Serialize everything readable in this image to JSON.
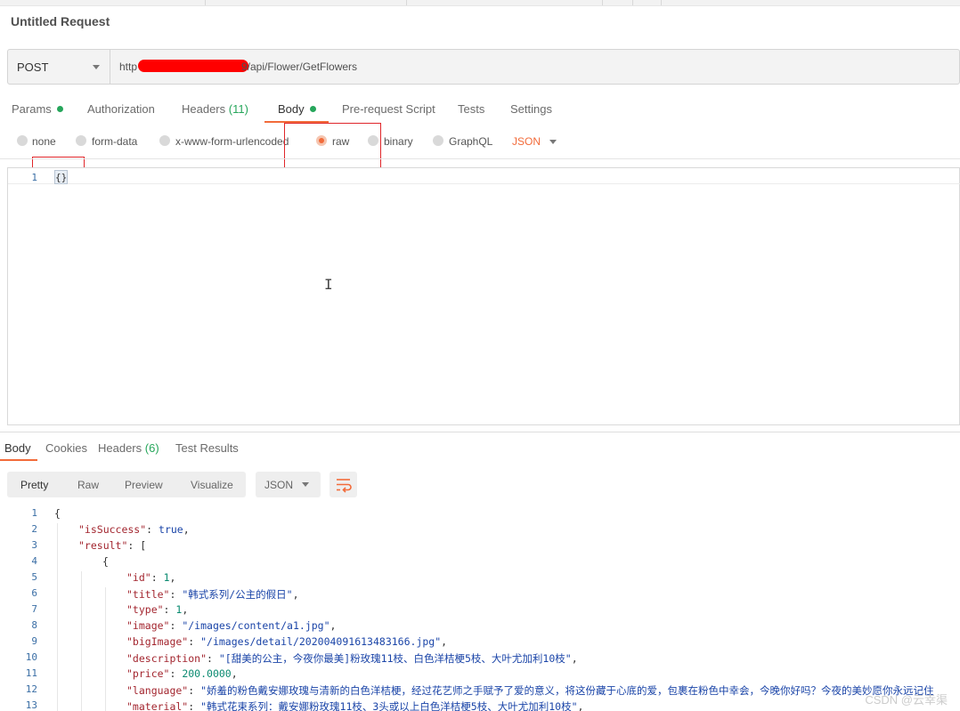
{
  "title": "Untitled Request",
  "request": {
    "method": "POST",
    "url_prefix": "http",
    "url_suffix": "9/api/Flower/GetFlowers",
    "tabs": [
      {
        "label": "Params"
      },
      {
        "label": "Authorization"
      },
      {
        "label": "Headers",
        "count": "(11)"
      },
      {
        "label": "Body"
      },
      {
        "label": "Pre-request Script"
      },
      {
        "label": "Tests"
      },
      {
        "label": "Settings"
      }
    ],
    "body_types": [
      "none",
      "form-data",
      "x-www-form-urlencoded",
      "raw",
      "binary",
      "GraphQL"
    ],
    "selected_body_type": "raw",
    "format": "JSON",
    "editor_line_number": "1",
    "editor_content": "{}"
  },
  "response": {
    "tabs": [
      {
        "label": "Body"
      },
      {
        "label": "Cookies"
      },
      {
        "label": "Headers",
        "count": "(6)"
      },
      {
        "label": "Test Results"
      }
    ],
    "view_modes": [
      "Pretty",
      "Raw",
      "Preview",
      "Visualize"
    ],
    "format": "JSON",
    "lines": [
      {
        "no": "1",
        "text": "{"
      },
      {
        "no": "2",
        "key": "\"isSuccess\"",
        "value": "true",
        "type": "b",
        "tail": ",",
        "indent": 1
      },
      {
        "no": "3",
        "key": "\"result\"",
        "value": "[",
        "type": "p",
        "indent": 1
      },
      {
        "no": "4",
        "text": "{",
        "indent": 2
      },
      {
        "no": "5",
        "key": "\"id\"",
        "value": "1",
        "type": "n",
        "tail": ",",
        "indent": 3
      },
      {
        "no": "6",
        "key": "\"title\"",
        "value": "\"韩式系列/公主的假日\"",
        "type": "s",
        "tail": ",",
        "indent": 3
      },
      {
        "no": "7",
        "key": "\"type\"",
        "value": "1",
        "type": "n",
        "tail": ",",
        "indent": 3
      },
      {
        "no": "8",
        "key": "\"image\"",
        "value": "\"/images/content/a1.jpg\"",
        "type": "s",
        "tail": ",",
        "indent": 3
      },
      {
        "no": "9",
        "key": "\"bigImage\"",
        "value": "\"/images/detail/202004091613483166.jpg\"",
        "type": "s",
        "tail": ",",
        "indent": 3
      },
      {
        "no": "10",
        "key": "\"description\"",
        "value": "\"[甜美的公主，今夜你最美]粉玫瑰11枝、白色洋桔梗5枝、大叶尤加利10枝\"",
        "type": "s",
        "tail": ",",
        "indent": 3
      },
      {
        "no": "11",
        "key": "\"price\"",
        "value": "200.0000",
        "type": "n",
        "tail": ",",
        "indent": 3
      },
      {
        "no": "12",
        "key": "\"language\"",
        "value": "\"娇羞的粉色戴安娜玫瑰与清新的白色洋桔梗，经过花艺师之手赋予了爱的意义，将这份藏于心底的爱，包裹在粉色中幸会，今晚你好吗？今夜的美妙愿你永远记住",
        "type": "s",
        "indent": 3
      },
      {
        "no": "13",
        "key": "\"material\"",
        "value": "\"韩式花束系列：戴安娜粉玫瑰11枝、3头或以上白色洋桔梗5枝、大叶尤加利10枝\"",
        "type": "s",
        "tail": ",",
        "indent": 3
      }
    ]
  },
  "watermark": "CSDN @云幸渠"
}
